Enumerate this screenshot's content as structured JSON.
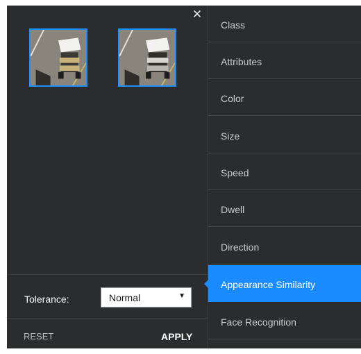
{
  "panel": {
    "close_icon": "close-icon",
    "thumbnails": [
      {
        "subject": "golf-cart-1"
      },
      {
        "subject": "golf-cart-2"
      }
    ],
    "accent_color": "#1a8cff",
    "tolerance": {
      "label": "Tolerance:",
      "value": "Normal"
    },
    "footer": {
      "reset_label": "RESET",
      "apply_label": "APPLY"
    }
  },
  "menu": {
    "items": [
      {
        "label": "Class"
      },
      {
        "label": "Attributes"
      },
      {
        "label": "Color"
      },
      {
        "label": "Size"
      },
      {
        "label": "Speed"
      },
      {
        "label": "Dwell"
      },
      {
        "label": "Direction"
      },
      {
        "label": "Appearance Similarity",
        "active": true
      },
      {
        "label": "Face Recognition"
      }
    ]
  }
}
